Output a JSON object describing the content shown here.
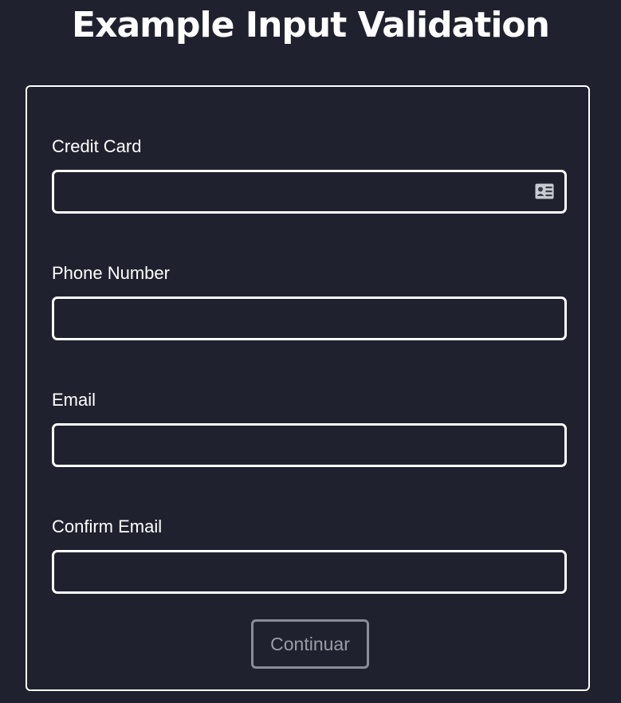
{
  "page": {
    "title": "Example Input Validation"
  },
  "form": {
    "fields": [
      {
        "label": "Credit Card",
        "value": "",
        "placeholder": ""
      },
      {
        "label": "Phone Number",
        "value": "",
        "placeholder": ""
      },
      {
        "label": "Email",
        "value": "",
        "placeholder": ""
      },
      {
        "label": "Confirm Email",
        "value": "",
        "placeholder": ""
      }
    ],
    "credit_card_icon": "contact-card-icon",
    "submit_label": "Continuar",
    "submit_disabled": true
  },
  "colors": {
    "background": "#1f212e",
    "border": "#ffffff",
    "disabled_button_border": "#8a8c97",
    "disabled_button_text": "#9b9da6"
  }
}
